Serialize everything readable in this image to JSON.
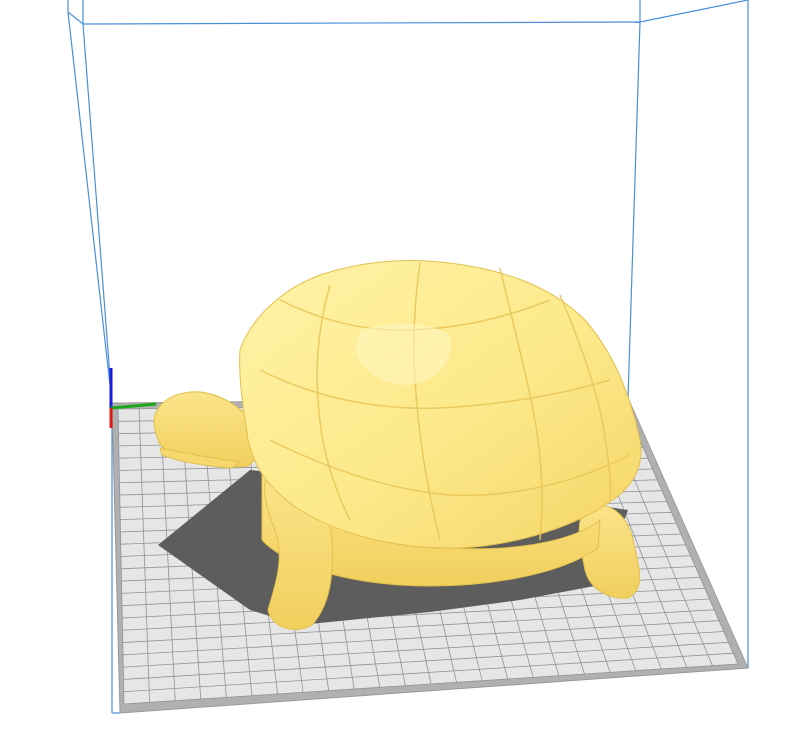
{
  "app": {
    "view": "3d-build-volume",
    "model_icon": "turtle-model",
    "colors": {
      "background": "#ffffff",
      "plate": "#e6e6e6",
      "plate_border": "#b3b3b3",
      "grid": "#9a9aa0",
      "volume_edges": "#4a90d9",
      "model_fill": "#fde98a",
      "model_shade": "#f2cf5a",
      "shadow": "#5a5a5a",
      "axis_x": "#e01b1b",
      "axis_y": "#1aa81a",
      "axis_z": "#1b1be0"
    }
  }
}
